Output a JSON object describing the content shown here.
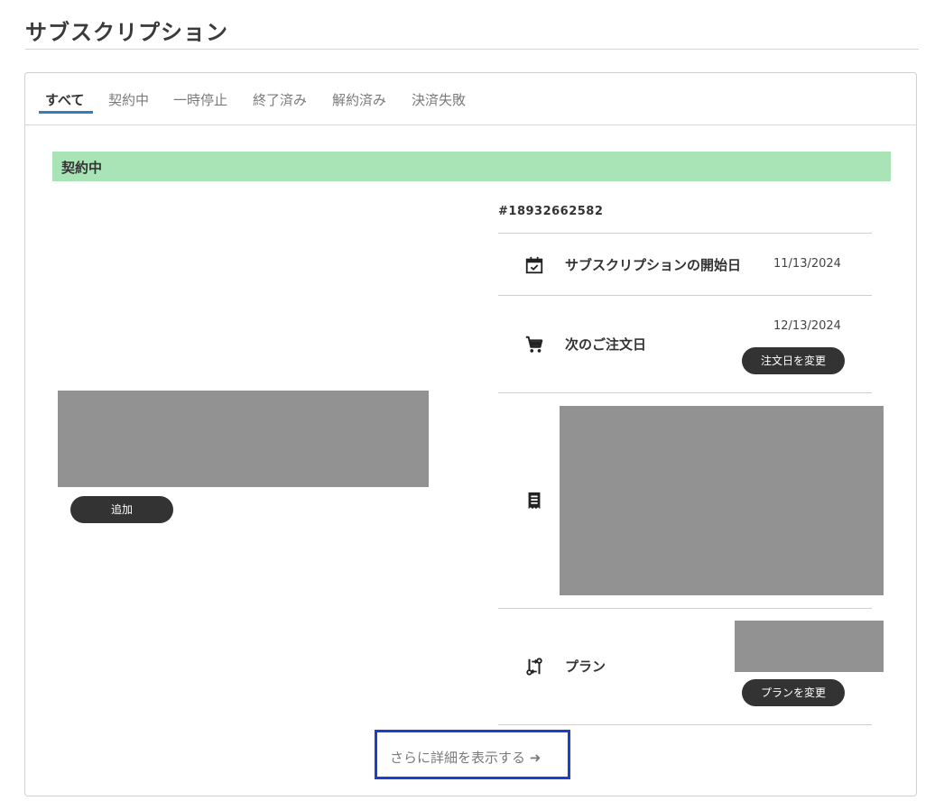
{
  "page": {
    "title": "サブスクリプション"
  },
  "tabs": [
    {
      "label": "すべて",
      "active": true
    },
    {
      "label": "契約中"
    },
    {
      "label": "一時停止"
    },
    {
      "label": "終了済み"
    },
    {
      "label": "解約済み"
    },
    {
      "label": "決済失敗"
    }
  ],
  "subscription": {
    "status_label": "契約中",
    "order_number": "#18932662582",
    "add_button": "追加",
    "start": {
      "label": "サブスクリプションの開始日",
      "value": "11/13/2024"
    },
    "next_order": {
      "label": "次のご注文日",
      "value": "12/13/2024",
      "button": "注文日を変更"
    },
    "plan": {
      "label": "プラン",
      "button": "プランを変更"
    },
    "more_link": "さらに詳細を表示する ➜"
  },
  "colors": {
    "status_bg": "#a8e4b6",
    "active_tab_underline": "#2f7fc1",
    "button_bg": "#333333",
    "placeholder": "#929292",
    "highlight_border": "#1a3fd0"
  }
}
